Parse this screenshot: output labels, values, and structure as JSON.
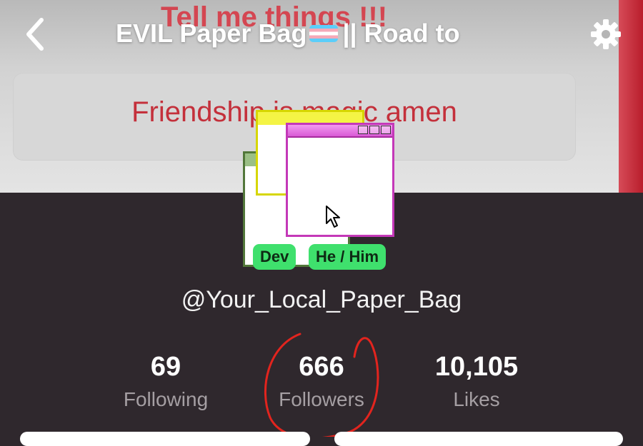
{
  "banner": {
    "top_text": "Tell me things !!!",
    "box_text": "Friendship is magic amen"
  },
  "header": {
    "title": "EVIL Paper Bag",
    "title_suffix": "|| Road to",
    "flag": "trans-flag-icon",
    "back_icon": "chevron-left-icon",
    "settings_icon": "gear-icon"
  },
  "profile": {
    "tags": [
      "Dev",
      "He / Him"
    ],
    "username": "@Your_Local_Paper_Bag"
  },
  "stats": [
    {
      "value": "69",
      "label": "Following"
    },
    {
      "value": "666",
      "label": "Followers"
    },
    {
      "value": "10,105",
      "label": "Likes"
    }
  ],
  "colors": {
    "background": "#2f282d",
    "tag": "#3fe06d",
    "annotation": "#e2241e"
  }
}
